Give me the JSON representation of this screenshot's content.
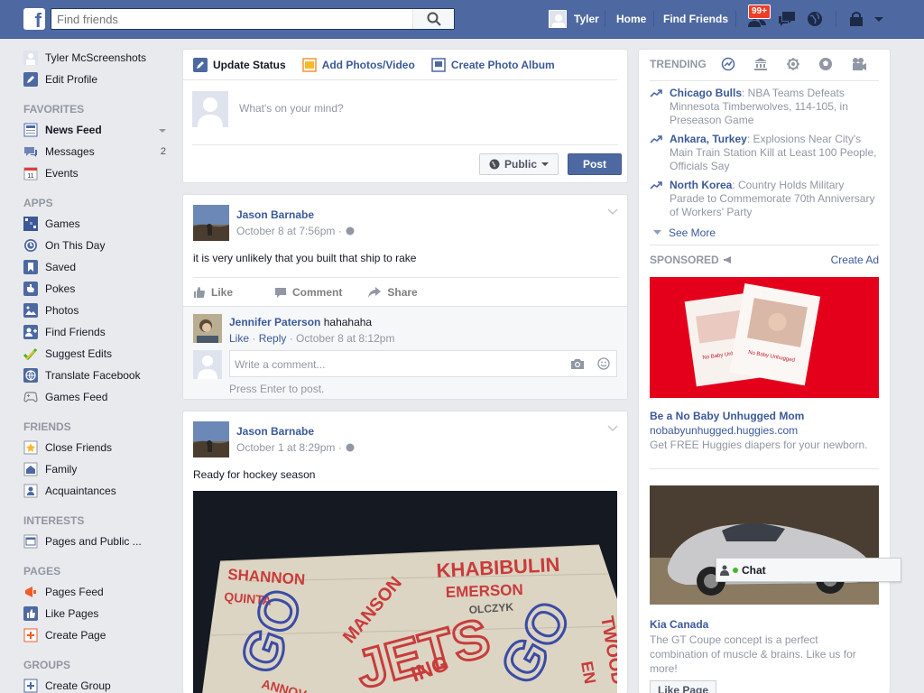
{
  "topbar": {
    "search_placeholder": "Find friends",
    "user_name": "Tyler",
    "home": "Home",
    "find_friends": "Find Friends",
    "friend_requests_badge": "99+",
    "bg_color": "#4e69a2"
  },
  "sidebar": {
    "profile_name": "Tyler McScreenshots",
    "edit_profile": "Edit Profile",
    "sections": [
      {
        "title": "FAVORITES",
        "items": [
          {
            "label": "News Feed",
            "icon": "news-feed-icon",
            "bold": true
          },
          {
            "label": "Messages",
            "icon": "messages-icon",
            "count": "2"
          },
          {
            "label": "Events",
            "icon": "events-icon"
          }
        ]
      },
      {
        "title": "APPS",
        "items": [
          {
            "label": "Games",
            "icon": "games-icon"
          },
          {
            "label": "On This Day",
            "icon": "on-this-day-icon"
          },
          {
            "label": "Saved",
            "icon": "saved-icon"
          },
          {
            "label": "Pokes",
            "icon": "pokes-icon"
          },
          {
            "label": "Photos",
            "icon": "photos-icon"
          },
          {
            "label": "Find Friends",
            "icon": "find-friends-icon"
          },
          {
            "label": "Suggest Edits",
            "icon": "suggest-edits-icon"
          },
          {
            "label": "Translate Facebook",
            "icon": "translate-icon"
          },
          {
            "label": "Games Feed",
            "icon": "games-feed-icon"
          }
        ]
      },
      {
        "title": "FRIENDS",
        "items": [
          {
            "label": "Close Friends",
            "icon": "close-friends-icon"
          },
          {
            "label": "Family",
            "icon": "family-icon"
          },
          {
            "label": "Acquaintances",
            "icon": "acquaintances-icon"
          }
        ]
      },
      {
        "title": "INTERESTS",
        "items": [
          {
            "label": "Pages and Public ...",
            "icon": "pages-public-icon"
          }
        ]
      },
      {
        "title": "PAGES",
        "items": [
          {
            "label": "Pages Feed",
            "icon": "pages-feed-icon"
          },
          {
            "label": "Like Pages",
            "icon": "like-pages-icon"
          },
          {
            "label": "Create Page",
            "icon": "create-page-icon"
          }
        ]
      },
      {
        "title": "GROUPS",
        "items": [
          {
            "label": "Create Group",
            "icon": "create-group-icon"
          }
        ]
      }
    ]
  },
  "composer": {
    "tabs": [
      "Update Status",
      "Add Photos/Video",
      "Create Photo Album"
    ],
    "placeholder": "What's on your mind?",
    "privacy": "Public",
    "post_button": "Post"
  },
  "posts": [
    {
      "author": "Jason Barnabe",
      "time": "October 8 at 7:56pm ·",
      "text": "it is very unlikely that you built that ship to rake",
      "actions": [
        "Like",
        "Comment",
        "Share"
      ],
      "comment": {
        "author": "Jennifer Paterson",
        "text": "hahahaha",
        "like": "Like",
        "reply": "Reply",
        "time": "October 8 at 8:12pm"
      },
      "comment_placeholder": "Write a comment...",
      "hint": "Press Enter to post."
    },
    {
      "author": "Jason Barnabe",
      "time": "October 1 at 8:29pm ·",
      "text": "Ready for hockey season",
      "photo_words": [
        "SHANNON",
        "QUINTA",
        "KHABIBULIN",
        "EMERSON",
        "MANSON",
        "OLCZYK",
        "GO",
        "JETS",
        "GO",
        "ING",
        "TWOOD",
        "EN",
        "ANNOV"
      ]
    }
  ],
  "trending": {
    "title": "TRENDING",
    "tab_icons": [
      "trending-icon",
      "politics-icon",
      "science-icon",
      "sports-icon",
      "entertainment-icon"
    ],
    "items": [
      {
        "topic": "Chicago Bulls",
        "text": ": NBA Teams Defeats Minnesota Timberwolves, 114-105, in Preseason Game"
      },
      {
        "topic": "Ankara, Turkey",
        "text": ": Explosions Near City's Main Train Station Kill at Least 100 People, Officials Say"
      },
      {
        "topic": "North Korea",
        "text": ": Country Holds Military Parade to Commemorate 70th Anniversary of Workers' Party"
      }
    ],
    "see_more": "See More"
  },
  "sponsored": {
    "title": "SPONSORED",
    "create_ad": "Create Ad",
    "ads": [
      {
        "title": "Be a No Baby Unhugged Mom",
        "url": "nobabyunhugged.huggies.com",
        "desc": "Get FREE Huggies diapers for your newborn.",
        "image_text": "No Baby Unhugged"
      },
      {
        "title": "Kia Canada",
        "desc": "The GT Coupe concept is a perfect combination of muscle & brains. Like us for more!",
        "button": "Like Page"
      }
    ]
  },
  "chat": {
    "label": "Chat"
  }
}
